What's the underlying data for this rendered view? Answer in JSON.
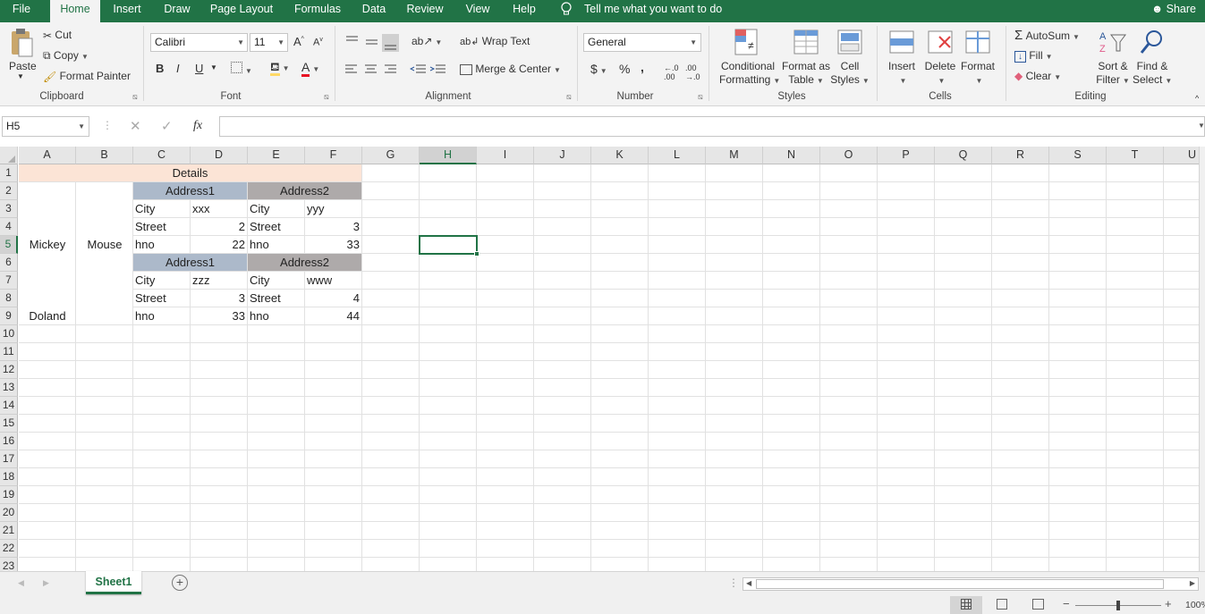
{
  "menu": {
    "tabs": [
      "File",
      "Home",
      "Insert",
      "Draw",
      "Page Layout",
      "Formulas",
      "Data",
      "Review",
      "View",
      "Help"
    ],
    "tell_me": "Tell me what you want to do",
    "share": "Share"
  },
  "ribbon": {
    "clipboard": {
      "paste": "Paste",
      "cut": "Cut",
      "copy": "Copy",
      "format_painter": "Format Painter",
      "label": "Clipboard"
    },
    "font": {
      "name": "Calibri",
      "size": "11",
      "bold": "B",
      "italic": "I",
      "underline": "U",
      "label": "Font"
    },
    "alignment": {
      "wrap": "Wrap Text",
      "merge": "Merge & Center",
      "label": "Alignment"
    },
    "number": {
      "format": "General",
      "currency": "$",
      "percent": "%",
      "comma": ",",
      "label": "Number"
    },
    "styles": {
      "conditional1": "Conditional",
      "conditional2": "Formatting",
      "format_as1": "Format as",
      "format_as2": "Table",
      "cell1": "Cell",
      "cell2": "Styles",
      "label": "Styles"
    },
    "cells": {
      "insert": "Insert",
      "delete": "Delete",
      "format": "Format",
      "label": "Cells"
    },
    "editing": {
      "autosum": "AutoSum",
      "fill": "Fill",
      "clear": "Clear",
      "sort1": "Sort &",
      "sort2": "Filter",
      "find1": "Find &",
      "find2": "Select",
      "label": "Editing"
    }
  },
  "formula_bar": {
    "name_box": "H5",
    "fx": "fx",
    "value": ""
  },
  "columns": [
    "A",
    "B",
    "C",
    "D",
    "E",
    "F",
    "G",
    "H",
    "I",
    "J",
    "K",
    "L",
    "M",
    "N",
    "O",
    "P",
    "Q",
    "R",
    "S",
    "T",
    "U"
  ],
  "rows": [
    "1",
    "2",
    "3",
    "4",
    "5",
    "6",
    "7",
    "8",
    "9",
    "10",
    "11",
    "12",
    "13",
    "14",
    "15",
    "16",
    "17",
    "18",
    "19",
    "20",
    "21",
    "22",
    "23"
  ],
  "cells": {
    "details": "Details",
    "addr1_a": "Address1",
    "addr2_a": "Address2",
    "addr1_b": "Address1",
    "addr2_b": "Address2",
    "r3c": "City",
    "r3d": "xxx",
    "r3e": "City",
    "r3f": "yyy",
    "r4c": "Street",
    "r4d": "2",
    "r4e": "Street",
    "r4f": "3",
    "r5a": "Mickey",
    "r5b": "Mouse",
    "r5c": "hno",
    "r5d": "22",
    "r5e": "hno",
    "r5f": "33",
    "r7c": "City",
    "r7d": "zzz",
    "r7e": "City",
    "r7f": "www",
    "r8c": "Street",
    "r8d": "3",
    "r8e": "Street",
    "r8f": "4",
    "r9a": "Doland",
    "r9c": "hno",
    "r9d": "33",
    "r9e": "hno",
    "r9f": "44"
  },
  "sheet_tab": "Sheet1",
  "zoom": "100%",
  "colors": {
    "excel_green": "#217346",
    "details_fill": "#fce4d6",
    "addr1_fill": "#acb9ca",
    "addr2_fill": "#aeaaaa"
  }
}
